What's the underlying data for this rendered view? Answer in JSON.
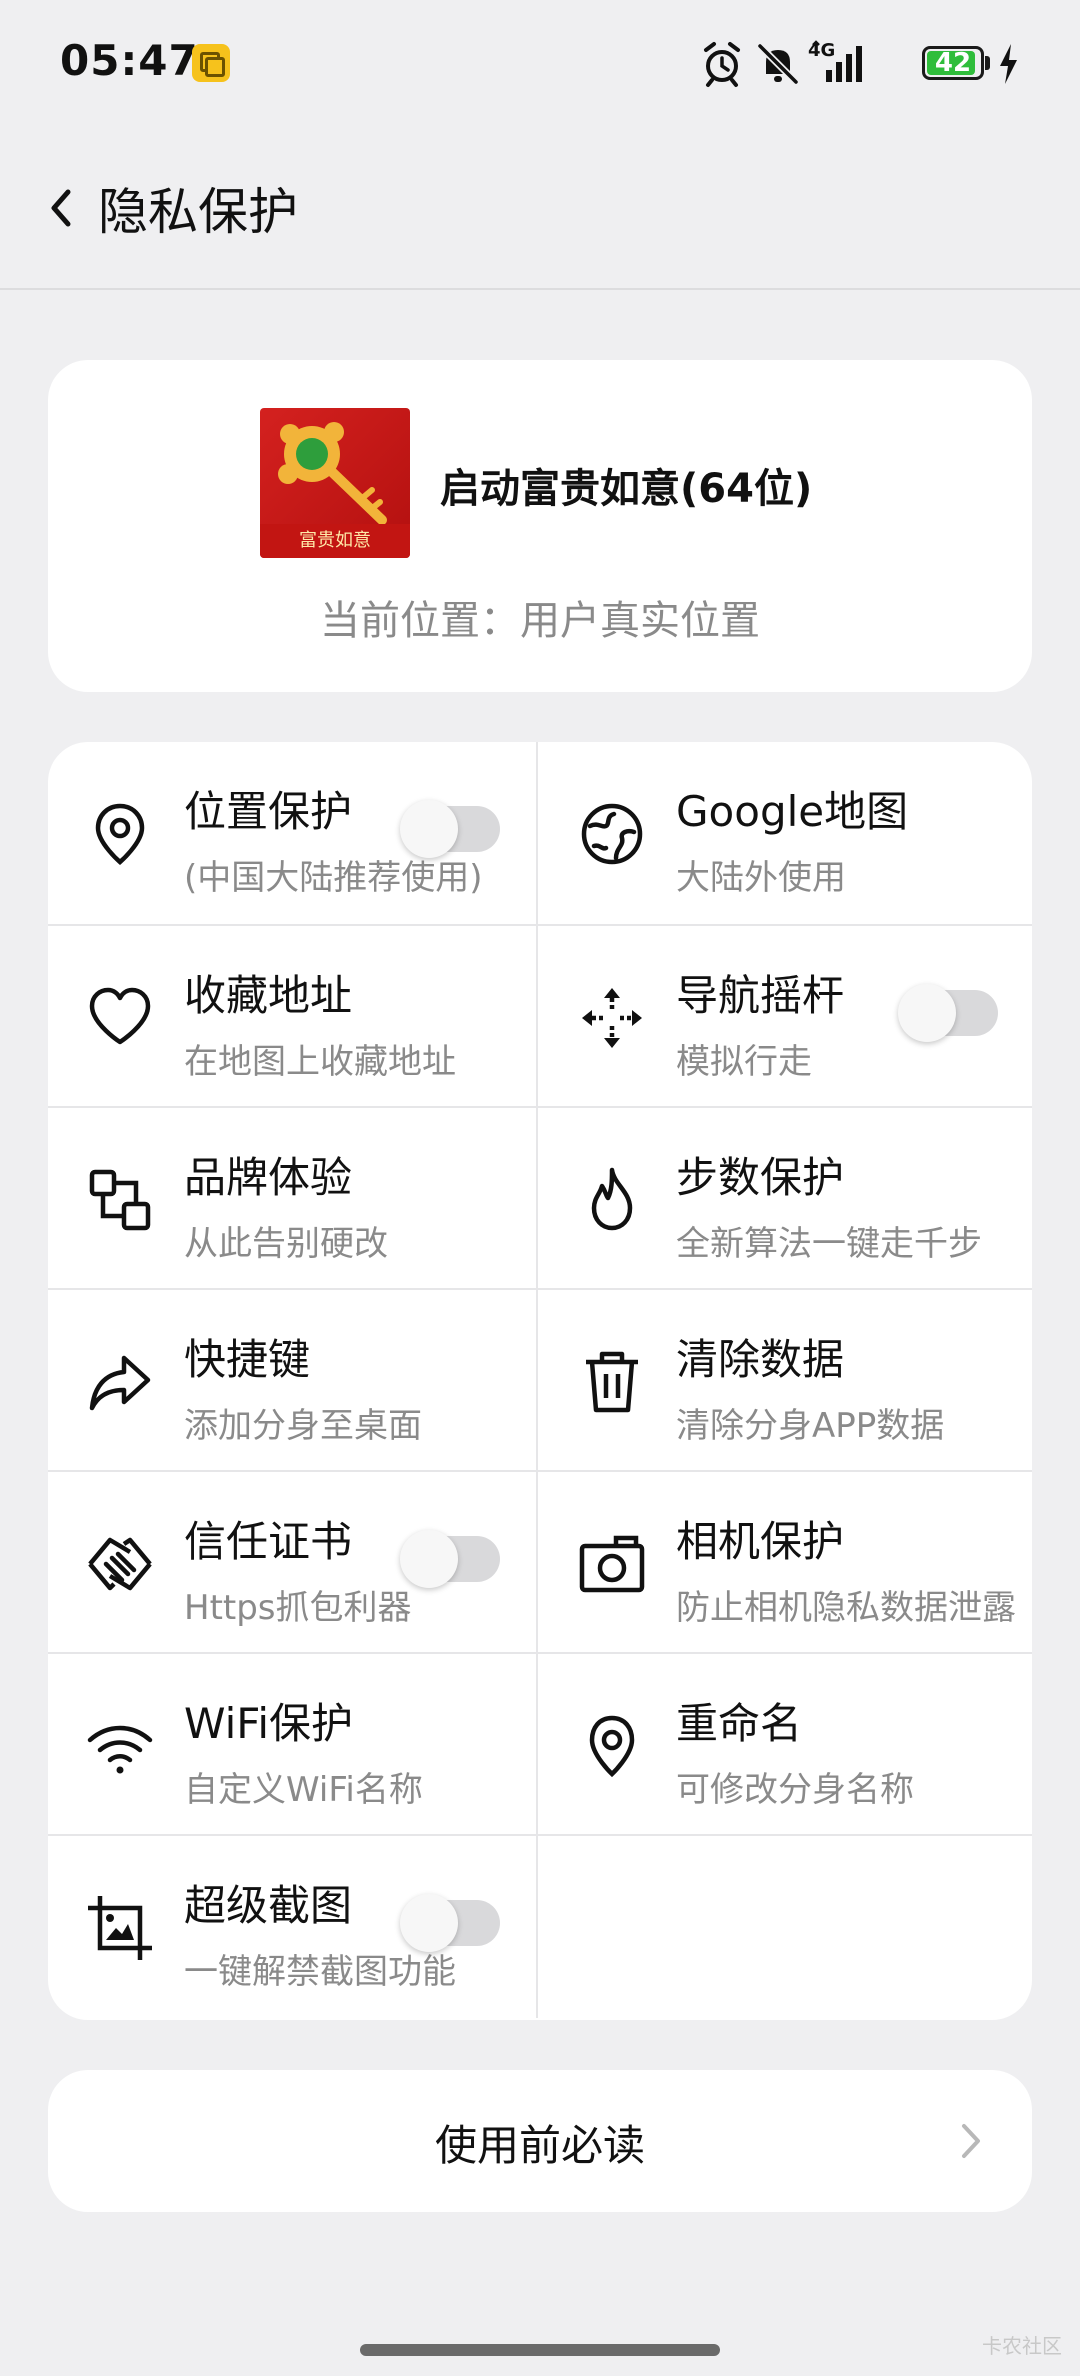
{
  "status_bar": {
    "time": "05:47",
    "network": "4G",
    "battery": "42",
    "battery_level": 0.42,
    "icons": [
      "notification-app-icon",
      "alarm-icon",
      "mute-icon",
      "signal-icon",
      "battery-icon",
      "charging-icon"
    ]
  },
  "header": {
    "back_icon": "chevron-left-icon",
    "title": "隐私保护"
  },
  "app": {
    "name": "启动富贵如意(64位)",
    "icon_label": "富贵如意",
    "location": "当前位置：用户真实位置"
  },
  "features": [
    {
      "title": "位置保护",
      "subtitle": "(中国大陆推荐使用)",
      "icon": "location-pin-icon",
      "toggle": false
    },
    {
      "title": "Google地图",
      "subtitle": "大陆外使用",
      "icon": "globe-icon"
    },
    {
      "title": "收藏地址",
      "subtitle": "在地图上收藏地址",
      "icon": "heart-icon"
    },
    {
      "title": "导航摇杆",
      "subtitle": "模拟行走",
      "icon": "move-arrows-icon",
      "toggle": false
    },
    {
      "title": "品牌体验",
      "subtitle": "从此告别硬改",
      "icon": "brand-devices-icon"
    },
    {
      "title": "步数保护",
      "subtitle": "全新算法一键走千步",
      "icon": "flame-icon"
    },
    {
      "title": "快捷键",
      "subtitle": "添加分身至桌面",
      "icon": "share-arrow-icon"
    },
    {
      "title": "清除数据",
      "subtitle": "清除分身APP数据",
      "icon": "trash-icon"
    },
    {
      "title": "信任证书",
      "subtitle": "Https抓包利器",
      "icon": "handshake-icon",
      "toggle": false
    },
    {
      "title": "相机保护",
      "subtitle": "防止相机隐私数据泄露",
      "icon": "camera-icon"
    },
    {
      "title": "WiFi保护",
      "subtitle": "自定义WiFi名称",
      "icon": "wifi-icon"
    },
    {
      "title": "重命名",
      "subtitle": "可修改分身名称",
      "icon": "location-pin-icon"
    },
    {
      "title": "超级截图",
      "subtitle": "一键解禁截图功能",
      "icon": "crop-image-icon",
      "toggle": false
    }
  ],
  "read_first": {
    "label": "使用前必读",
    "icon": "chevron-right-icon"
  },
  "watermark": "卡农社区",
  "colors": {
    "background": "#efeff1",
    "card": "#ffffff",
    "subtitle": "#8a8a8a",
    "toggle_off": "#d9d9db",
    "battery": "#2fbd3b",
    "notification": "#f6c21c"
  }
}
